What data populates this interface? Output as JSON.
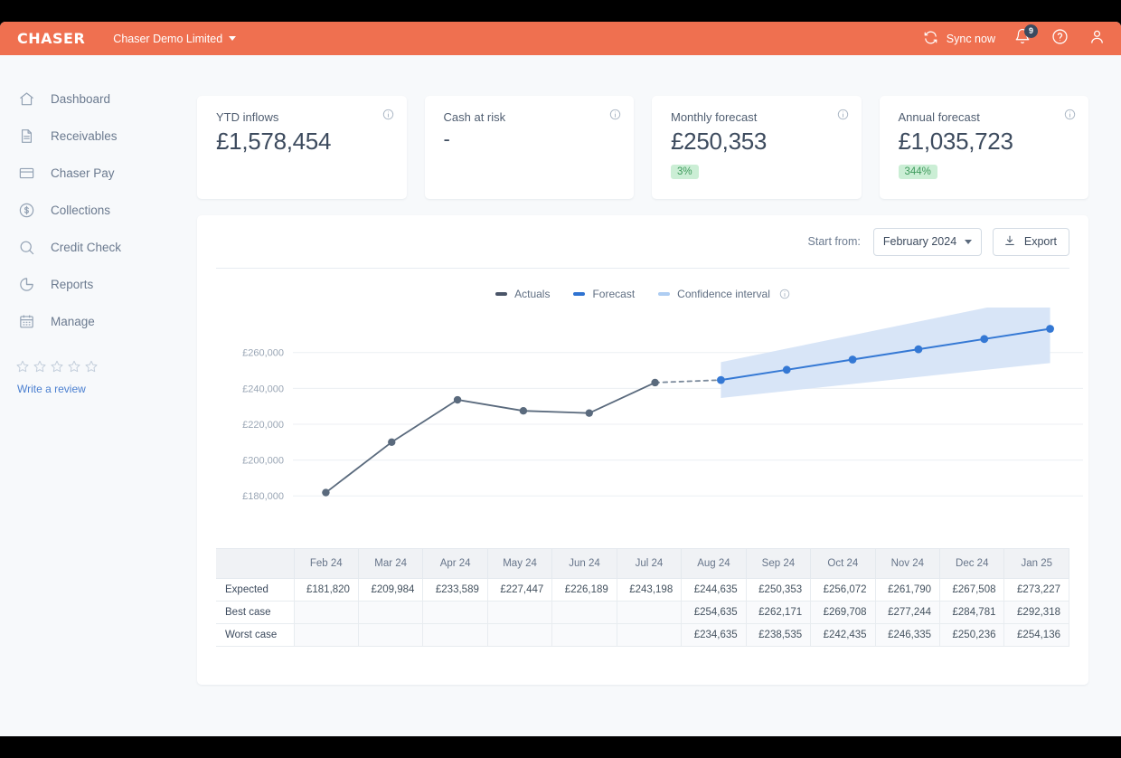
{
  "topbar": {
    "logo": "CHASER",
    "org": "Chaser Demo Limited",
    "sync_label": "Sync now",
    "notification_count": "9",
    "accent_color": "#ef7050"
  },
  "sidebar": {
    "items": [
      {
        "label": "Dashboard",
        "icon": "home-icon"
      },
      {
        "label": "Receivables",
        "icon": "document-icon"
      },
      {
        "label": "Chaser Pay",
        "icon": "credit-card-icon"
      },
      {
        "label": "Collections",
        "icon": "dollar-circle-icon"
      },
      {
        "label": "Credit Check",
        "icon": "search-icon"
      },
      {
        "label": "Reports",
        "icon": "pie-chart-icon"
      },
      {
        "label": "Manage",
        "icon": "calendar-icon"
      }
    ],
    "review": {
      "stars": 5,
      "filled": 0,
      "link_label": "Write a review",
      "link_color": "#4a7fd0"
    }
  },
  "cards": [
    {
      "label": "YTD inflows",
      "value": "£1,578,454",
      "pill": null
    },
    {
      "label": "Cash at risk",
      "value": "-",
      "pill": null
    },
    {
      "label": "Monthly forecast",
      "value": "£250,353",
      "pill": "3%"
    },
    {
      "label": "Annual forecast",
      "value": "£1,035,723",
      "pill": "344%"
    }
  ],
  "toolbar": {
    "start_from_label": "Start from:",
    "start_from_value": "February 2024",
    "export_label": "Export"
  },
  "legend": [
    {
      "label": "Actuals",
      "color": "#4a5568"
    },
    {
      "label": "Forecast",
      "color": "#2f73d1"
    },
    {
      "label": "Confidence interval",
      "color": "#aecdf2"
    }
  ],
  "chart_data": {
    "type": "line",
    "title": "",
    "xlabel": "",
    "ylabel": "",
    "grid": true,
    "legend_position": "top-center",
    "ylim": [
      170000,
      276000
    ],
    "yticks": [
      180000,
      200000,
      220000,
      240000,
      260000
    ],
    "ytick_labels": [
      "£180,000",
      "£200,000",
      "£220,000",
      "£240,000",
      "£260,000"
    ],
    "categories": [
      "Feb 24",
      "Mar 24",
      "Apr 24",
      "May 24",
      "Jun 24",
      "Jul 24",
      "Aug 24",
      "Sep 24",
      "Oct 24",
      "Nov 24",
      "Dec 24",
      "Jan 25"
    ],
    "series": [
      {
        "name": "Actuals",
        "color": "#4a5568",
        "x": [
          "Feb 24",
          "Mar 24",
          "Apr 24",
          "May 24",
          "Jun 24",
          "Jul 24"
        ],
        "values": [
          181820,
          209984,
          233589,
          227447,
          226189,
          243198
        ]
      },
      {
        "name": "Forecast",
        "color": "#2f73d1",
        "x": [
          "Aug 24",
          "Sep 24",
          "Oct 24",
          "Nov 24",
          "Dec 24",
          "Jan 25"
        ],
        "values": [
          244635,
          250353,
          256072,
          261790,
          267508,
          273227
        ]
      },
      {
        "name": "Confidence interval upper",
        "color": "#aecdf2",
        "x": [
          "Aug 24",
          "Sep 24",
          "Oct 24",
          "Nov 24",
          "Dec 24",
          "Jan 25"
        ],
        "values": [
          254635,
          262171,
          269708,
          277244,
          284781,
          292318
        ]
      },
      {
        "name": "Confidence interval lower",
        "color": "#aecdf2",
        "x": [
          "Aug 24",
          "Sep 24",
          "Oct 24",
          "Nov 24",
          "Dec 24",
          "Jan 25"
        ],
        "values": [
          234635,
          238535,
          242435,
          246335,
          250236,
          254136
        ]
      }
    ]
  },
  "table": {
    "columns": [
      "",
      "Feb 24",
      "Mar 24",
      "Apr 24",
      "May 24",
      "Jun 24",
      "Jul 24",
      "Aug 24",
      "Sep 24",
      "Oct 24",
      "Nov 24",
      "Dec 24",
      "Jan 25"
    ],
    "rows": [
      {
        "label": "Expected",
        "cells": [
          "£181,820",
          "£209,984",
          "£233,589",
          "£227,447",
          "£226,189",
          "£243,198",
          "£244,635",
          "£250,353",
          "£256,072",
          "£261,790",
          "£267,508",
          "£273,227"
        ]
      },
      {
        "label": "Best case",
        "cells": [
          "",
          "",
          "",
          "",
          "",
          "",
          "£254,635",
          "£262,171",
          "£269,708",
          "£277,244",
          "£284,781",
          "£292,318"
        ]
      },
      {
        "label": "Worst case",
        "cells": [
          "",
          "",
          "",
          "",
          "",
          "",
          "£234,635",
          "£238,535",
          "£242,435",
          "£246,335",
          "£250,236",
          "£254,136"
        ]
      }
    ]
  }
}
